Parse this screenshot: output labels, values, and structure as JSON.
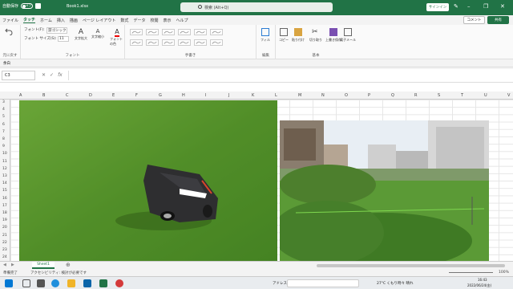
{
  "titlebar": {
    "autosave_label": "自動保存",
    "autosave_state": "オフ",
    "filename": "Book1.xlsx",
    "search_placeholder": "検索 (Alt+Q)",
    "signin": "サインイン",
    "accent": "#217346"
  },
  "menu": {
    "tabs": [
      "ファイル",
      "タッチ",
      "ホーム",
      "挿入",
      "描画",
      "ページ レイアウト",
      "数式",
      "データ",
      "校閲",
      "表示",
      "ヘルプ"
    ],
    "active": "タッチ",
    "comment": "コメント",
    "share": "共有"
  },
  "ribbon": {
    "undo": "元に戻す",
    "font_name_label": "フォント(F):",
    "font_name_value": "游ゴシック",
    "font_size_label": "フォント サイズ(S):",
    "font_size_value": "11",
    "grow": "文字拡大",
    "shrink": "文字縮小",
    "font_color": "フォントの色",
    "group_font": "フォント",
    "group_handwriting": "手書き",
    "fill": "フィル",
    "group_edit": "編集",
    "copy": "コピー",
    "paste": "貼り付け",
    "cut": "切り取り",
    "save": "上書き保存",
    "email": "電子メール",
    "group_basic": "基本"
  },
  "quickbar": {
    "item": "余白"
  },
  "formula": {
    "namebox": "C3",
    "fx": "fx"
  },
  "columns": [
    "A",
    "B",
    "C",
    "D",
    "E",
    "F",
    "G",
    "H",
    "I",
    "J",
    "K",
    "L",
    "M",
    "N",
    "O",
    "P",
    "Q",
    "R",
    "S",
    "T",
    "U",
    "V"
  ],
  "rows": [
    "3",
    "4",
    "5",
    "6",
    "7",
    "8",
    "9",
    "10",
    "11",
    "12",
    "13",
    "14",
    "15",
    "16",
    "17",
    "18",
    "19",
    "20",
    "21",
    "22",
    "23",
    "24"
  ],
  "sheets": {
    "tab": "Sheet1"
  },
  "status": {
    "ready": "準備完了",
    "accessibility": "アクセシビリティ: 検討が必要です",
    "zoom": "100%"
  },
  "taskbar": {
    "search_label": "アドレス",
    "weather": "27°C  くもり時々 晴れ",
    "time": "16:43",
    "date": "2022/06/24(金)"
  }
}
